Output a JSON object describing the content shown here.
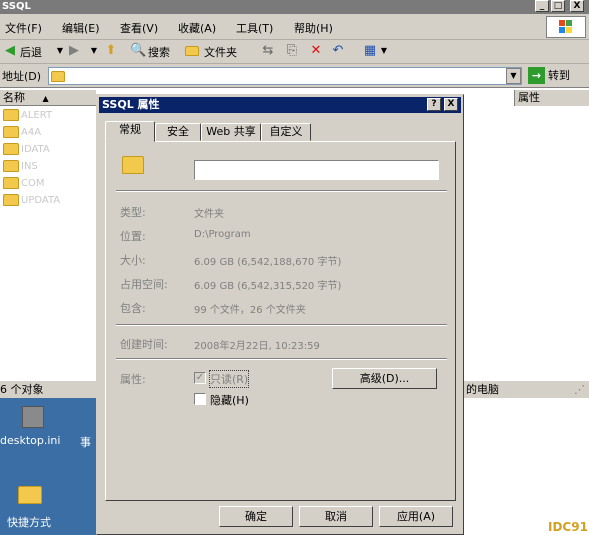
{
  "window": {
    "title": "SSQL",
    "min": "_",
    "max": "□",
    "close": "X"
  },
  "menu": {
    "file": "文件(F)",
    "edit": "编辑(E)",
    "view": "查看(V)",
    "favorites": "收藏(A)",
    "tools": "工具(T)",
    "help": "帮助(H)"
  },
  "toolbar": {
    "back": "后退",
    "search": "搜索",
    "folders": "文件夹"
  },
  "address": {
    "label": "地址(D)",
    "go": "转到"
  },
  "list": {
    "header_name": "名称",
    "header_attr": "属性",
    "items": [
      "ALERT",
      "A4A",
      "IDATA",
      "INS",
      "COM",
      "UPDATA"
    ]
  },
  "status": {
    "objects": "6 个对象",
    "computer": "的电脑"
  },
  "desktop": {
    "icon1": "desktop.ini",
    "icon1b": "事",
    "icon2": "快捷方式"
  },
  "dialog": {
    "title": "SSQL 属性",
    "help": "?",
    "close": "X",
    "tabs": [
      "常规",
      "安全",
      "Web 共享",
      "自定义"
    ],
    "name_value": "",
    "rows": {
      "type_label": "类型:",
      "type_value": "文件夹",
      "location_label": "位置:",
      "location_value": "D:\\Program",
      "size_label": "大小:",
      "size_value": "6.09 GB (6,542,188,670 字节)",
      "disk_label": "占用空间:",
      "disk_value": "6.09 GB (6,542,315,520 字节)",
      "contains_label": "包含:",
      "contains_value": "99 个文件，26 个文件夹",
      "created_label": "创建时间:",
      "created_value": "2008年2月22日, 10:23:59",
      "attr_label": "属性:",
      "readonly_label": "只读(R)",
      "hidden_label": "隐藏(H)",
      "advanced": "高级(D)..."
    },
    "buttons": {
      "ok": "确定",
      "cancel": "取消",
      "apply": "应用(A)"
    }
  },
  "watermark": "IDC91"
}
